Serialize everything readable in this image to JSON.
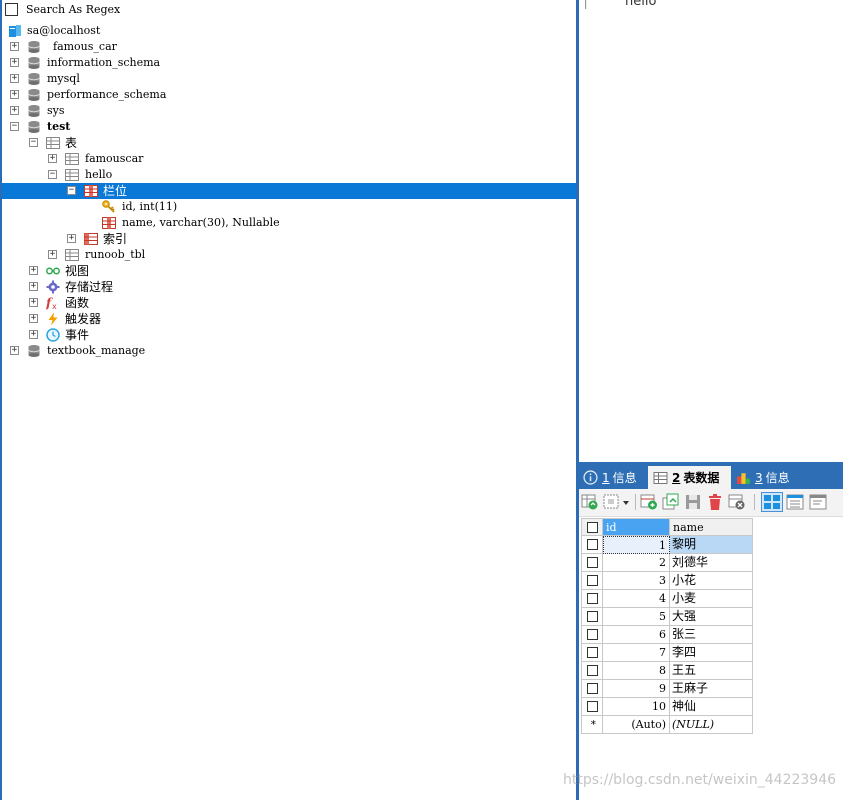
{
  "search": {
    "label": "Search As Regex"
  },
  "tree": {
    "connection": "sa@localhost",
    "databases": {
      "famous_car": "famous_car",
      "information_schema": "information_schema",
      "mysql": "mysql",
      "performance_schema": "performance_schema",
      "sys": "sys",
      "test": "test",
      "textbook_manage": "textbook_manage"
    },
    "test_children": {
      "tables": "表",
      "views": "视图",
      "procedures": "存储过程",
      "functions": "函数",
      "triggers": "触发器",
      "events": "事件"
    },
    "tables": {
      "famouscar": "famouscar",
      "hello": "hello",
      "runoob_tbl": "runoob_tbl"
    },
    "hello_children": {
      "columns": "栏位",
      "indexes": "索引"
    },
    "columns": [
      "id, int(11)",
      "name, varchar(30), Nullable"
    ]
  },
  "query": {
    "text": "hello"
  },
  "tabs": [
    {
      "num": "1",
      "label": "信息"
    },
    {
      "num": "2",
      "label": "表数据"
    },
    {
      "num": "3",
      "label": "信息"
    }
  ],
  "colors": {
    "selection": "#0a78d7",
    "tab_bar": "#2e6eb5",
    "header_selected": "#4aa3f0"
  },
  "grid": {
    "headers": [
      "id",
      "name"
    ],
    "rows": [
      {
        "id": "1",
        "name": "黎明"
      },
      {
        "id": "2",
        "name": "刘德华"
      },
      {
        "id": "3",
        "name": "小花"
      },
      {
        "id": "4",
        "name": "小麦"
      },
      {
        "id": "5",
        "name": "大强"
      },
      {
        "id": "6",
        "name": "张三"
      },
      {
        "id": "7",
        "name": "李四"
      },
      {
        "id": "8",
        "name": "王五"
      },
      {
        "id": "9",
        "name": "王麻子"
      },
      {
        "id": "10",
        "name": "神仙"
      }
    ],
    "new_row": {
      "marker": "*",
      "id": "(Auto)",
      "name": "(NULL)"
    }
  },
  "watermark": "https://blog.csdn.net/weixin_44223946"
}
